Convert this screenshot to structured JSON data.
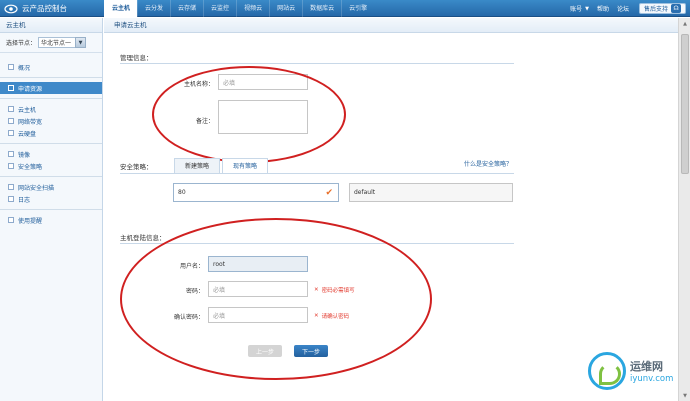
{
  "app": {
    "title": "云产品控制台",
    "logo_icon": "cloud-eye-logo-icon"
  },
  "topnav": {
    "tabs": [
      {
        "label": "云主机",
        "active": true
      },
      {
        "label": "云分发",
        "active": false
      },
      {
        "label": "云存储",
        "active": false
      },
      {
        "label": "云监控",
        "active": false
      },
      {
        "label": "视频云",
        "active": false
      },
      {
        "label": "网站云",
        "active": false
      },
      {
        "label": "数据库云",
        "active": false
      },
      {
        "label": "云引擎",
        "active": false
      }
    ],
    "account": "账号",
    "help": "帮助",
    "forum": "论坛",
    "support": "售后支持"
  },
  "sidebar": {
    "header": "云主机",
    "node_label": "选择节点：",
    "node_value": "华北节点一",
    "items": [
      {
        "label": "概况"
      },
      {
        "label": "申请资源",
        "active": true
      },
      {
        "label": "云主机"
      },
      {
        "label": "网络带宽"
      },
      {
        "label": "云硬盘"
      },
      {
        "label": "镜像"
      },
      {
        "label": "安全策略"
      },
      {
        "label": "网站安全扫描"
      },
      {
        "label": "日志"
      },
      {
        "label": "使用提醒"
      }
    ]
  },
  "main": {
    "breadcrumb": "申请云主机",
    "mgmt": {
      "title": "管理信息：",
      "host_label": "主机名称：",
      "host_placeholder": "必填",
      "remark_label": "备注："
    },
    "security": {
      "title": "安全策略：",
      "tab_new": "新建策略",
      "tab_existing": "现有策略",
      "help_link": "什么是安全策略？",
      "port_value": "80",
      "policy_value": "default"
    },
    "login": {
      "title": "主机登陆信息：",
      "user_label": "用户名：",
      "user_value": "root",
      "pwd_label": "密码：",
      "pwd_placeholder": "必填",
      "pwd_error": "密码必需填写",
      "confirm_label": "确认密码：",
      "confirm_placeholder": "必填",
      "confirm_error": "请确认密码"
    },
    "buttons": {
      "prev": "上一步",
      "next": "下一步"
    }
  },
  "watermark": {
    "line1": "运维网",
    "line2": "iyunv.com"
  },
  "colors": {
    "accent": "#2b6fb0",
    "annotation": "#d02020",
    "error": "#e23a2e"
  }
}
